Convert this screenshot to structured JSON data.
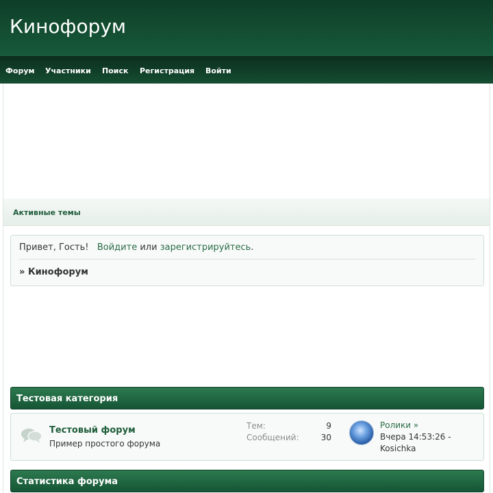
{
  "header": {
    "site_title": "Кинофорум"
  },
  "nav": {
    "items": [
      {
        "label": "Форум"
      },
      {
        "label": "Участники"
      },
      {
        "label": "Поиск"
      },
      {
        "label": "Регистрация"
      },
      {
        "label": "Войти"
      }
    ]
  },
  "tabs": {
    "active_topics": "Активные темы"
  },
  "greeting": {
    "prefix": "Привет, Гость!",
    "login_link": "Войдите",
    "or": "или",
    "register_link": "зарегистрируйтесь",
    "suffix": "."
  },
  "breadcrumb": {
    "arrow": "»",
    "label": "Кинофорум"
  },
  "category": {
    "title": "Тестовая категория",
    "board": {
      "name": "Тестовый форум",
      "description": "Пример простого форума",
      "topics_label": "Тем:",
      "topics_value": "9",
      "posts_label": "Сообщений:",
      "posts_value": "30",
      "last_post": {
        "topic": "Ролики",
        "arrow": "»",
        "time": "Вчера 14:53:26 -",
        "user": "Kosichka"
      }
    }
  },
  "stats": {
    "title": "Статистика форума"
  },
  "colors": {
    "header": "#0e3e28",
    "accent": "#1e5c3a",
    "category_bar": "#155535"
  },
  "icons": {
    "board_icon": "chat-bubbles-icon",
    "avatar": "user-avatar"
  }
}
